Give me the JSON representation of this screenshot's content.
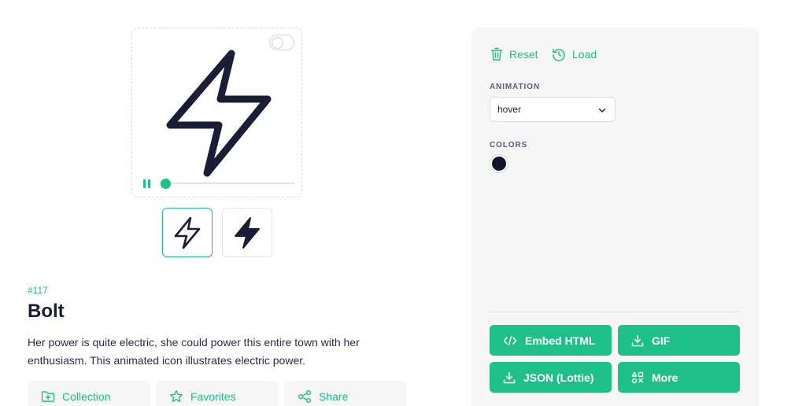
{
  "icon": {
    "number": "#117",
    "title": "Bolt",
    "description": "Her power is quite electric, she could power this entire town with her enthusiasm. This animated icon illustrates electric power."
  },
  "preview": {
    "variants": [
      "outline",
      "filled"
    ],
    "active_variant": "outline",
    "playback_progress": 0.0
  },
  "actions": {
    "collection": "Collection",
    "favorites": "Favorites",
    "share": "Share"
  },
  "panel": {
    "reset": "Reset",
    "load": "Load",
    "animation_label": "ANIMATION",
    "animation_value": "hover",
    "colors_label": "COLORS",
    "colors": [
      "#121331"
    ],
    "buttons": {
      "embed": "Embed HTML",
      "gif": "GIF",
      "json": "JSON (Lottie)",
      "more": "More"
    }
  },
  "accent_color": "#1ec087"
}
